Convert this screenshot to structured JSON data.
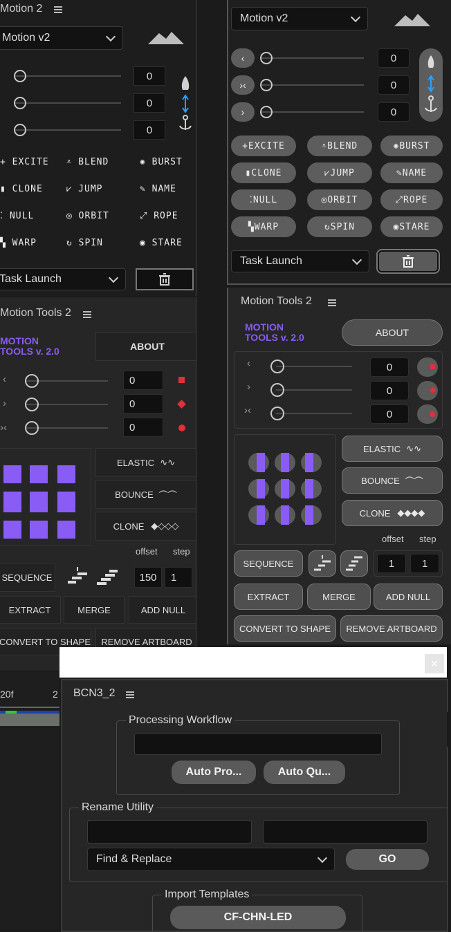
{
  "left_top": {
    "title": "Motion 2",
    "dropdown": "Motion v2",
    "values": [
      "0",
      "0",
      "0"
    ],
    "buttons": [
      "EXCITE",
      "BLEND",
      "BURST",
      "CLONE",
      "JUMP",
      "NAME",
      "NULL",
      "ORBIT",
      "ROPE",
      "WARP",
      "SPIN",
      "STARE"
    ],
    "launch": "Task Launch"
  },
  "right_top": {
    "dropdown": "Motion v2",
    "values": [
      "0",
      "0",
      "0"
    ],
    "buttons": [
      "EXCITE",
      "BLEND",
      "BURST",
      "CLONE",
      "JUMP",
      "NAME",
      "NULL",
      "ORBIT",
      "ROPE",
      "WARP",
      "SPIN",
      "STARE"
    ],
    "launch": "Task Launch"
  },
  "left_mt": {
    "title": "Motion Tools 2",
    "logo": "MOTION\nTOOLS v. 2.0",
    "about": "ABOUT",
    "values": [
      "0",
      "0",
      "0"
    ],
    "ease": [
      "ELASTIC",
      "BOUNCE",
      "CLONE"
    ],
    "offset_label": "offset",
    "step_label": "step",
    "sequence": "SEQUENCE",
    "offset": "150",
    "step": "1",
    "extract": "EXTRACT",
    "merge": "MERGE",
    "add_null": "ADD NULL",
    "convert": "CONVERT TO SHAPE",
    "remove": "REMOVE ARTBOARD"
  },
  "right_mt": {
    "title": "Motion Tools 2",
    "logo_line1": "MOTION",
    "logo_line2": "TOOLS v. 2.0",
    "about": "ABOUT",
    "values": [
      "0",
      "0",
      "0"
    ],
    "ease": [
      "ELASTIC",
      "BOUNCE",
      "CLONE"
    ],
    "offset_label": "offset",
    "step_label": "step",
    "sequence": "SEQUENCE",
    "offset": "1",
    "step": "1",
    "extract": "EXTRACT",
    "merge": "MERGE",
    "add_null": "ADD NULL",
    "convert": "CONVERT TO SHAPE",
    "remove": "REMOVE ARTBOARD"
  },
  "timeline": {
    "frame": "20f",
    "frame2": "2"
  },
  "bcn": {
    "title": "BCN3_2",
    "workflow_legend": "Processing Workflow",
    "auto_pro": "Auto Pro...",
    "auto_qu": "Auto Qu...",
    "rename_legend": "Rename Utility",
    "mode": "Find & Replace",
    "go": "GO",
    "import_legend": "Import Templates",
    "template": "CF-CHN-LED"
  },
  "colors": {
    "accent": "#8a5cf6",
    "red": "#e0303a",
    "blue": "#2aa0ff"
  }
}
